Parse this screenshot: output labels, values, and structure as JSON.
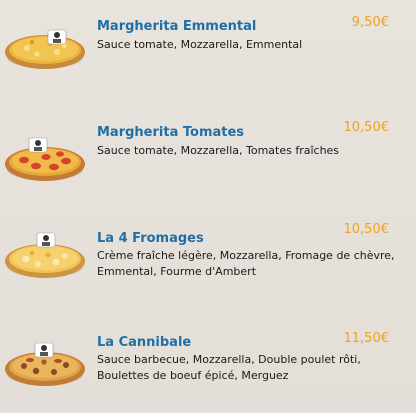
{
  "menu": {
    "items": [
      {
        "name": "Margherita Emmental",
        "description": "Sauce tomate, Mozzarella, Emmental",
        "price": "9,50€",
        "image_icon": "pizza-image"
      },
      {
        "name": "Margherita Tomates",
        "description": "Sauce tomate, Mozzarella, Tomates fraîches",
        "price": "10,50€",
        "image_icon": "pizza-image"
      },
      {
        "name": "La 4 Fromages",
        "description": "Crème fraîche légère, Mozzarella, Fromage de chèvre, Emmental, Fourme d'Ambert",
        "price": "10,50€",
        "image_icon": "pizza-image"
      },
      {
        "name": "La Cannibale",
        "description": "Sauce barbecue, Mozzarella, Double poulet rôti, Boulettes de boeuf épicé, Merguez",
        "price": "11,50€",
        "image_icon": "pizza-image"
      }
    ]
  },
  "colors": {
    "background": "#e5e1da",
    "name": "#1f6fa6",
    "price": "#f0a21d",
    "text": "#1a1a1a"
  }
}
